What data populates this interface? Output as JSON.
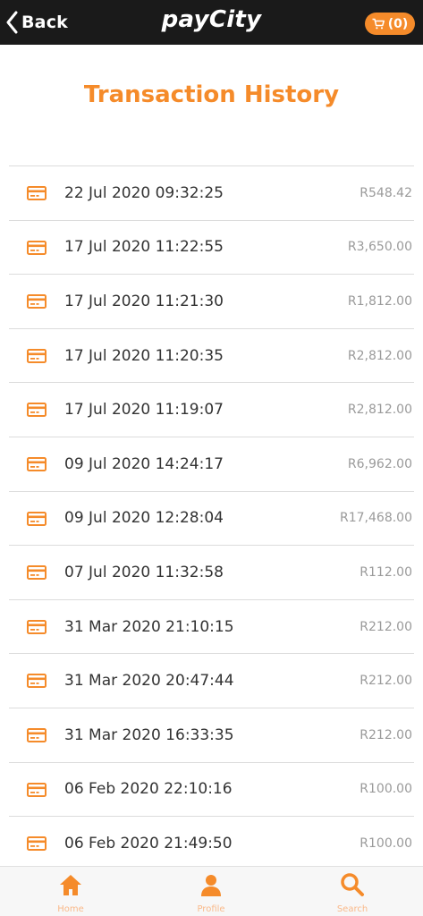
{
  "header": {
    "back_label": "Back",
    "brand": "payCity",
    "cart_count": "(0)"
  },
  "title": "Transaction History",
  "transactions": [
    {
      "date": "22 Jul 2020 09:32:25",
      "amount": "R548.42"
    },
    {
      "date": "17 Jul 2020 11:22:55",
      "amount": "R3,650.00"
    },
    {
      "date": "17 Jul 2020 11:21:30",
      "amount": "R1,812.00"
    },
    {
      "date": "17 Jul 2020 11:20:35",
      "amount": "R2,812.00"
    },
    {
      "date": "17 Jul 2020 11:19:07",
      "amount": "R2,812.00"
    },
    {
      "date": "09 Jul 2020 14:24:17",
      "amount": "R6,962.00"
    },
    {
      "date": "09 Jul 2020 12:28:04",
      "amount": "R17,468.00"
    },
    {
      "date": "07 Jul 2020 11:32:58",
      "amount": "R112.00"
    },
    {
      "date": "31 Mar 2020 21:10:15",
      "amount": "R212.00"
    },
    {
      "date": "31 Mar 2020 20:47:44",
      "amount": "R212.00"
    },
    {
      "date": "31 Mar 2020 16:33:35",
      "amount": "R212.00"
    },
    {
      "date": "06 Feb 2020 22:10:16",
      "amount": "R100.00"
    },
    {
      "date": "06 Feb 2020 21:49:50",
      "amount": "R100.00"
    }
  ],
  "bottom_nav": [
    {
      "label": "Home",
      "icon": "home-icon"
    },
    {
      "label": "Profile",
      "icon": "profile-icon"
    },
    {
      "label": "Search",
      "icon": "search-icon"
    }
  ],
  "colors": {
    "accent": "#f58b2a",
    "header_bg": "#1a1a1a",
    "nav_label": "#f9b98a"
  }
}
